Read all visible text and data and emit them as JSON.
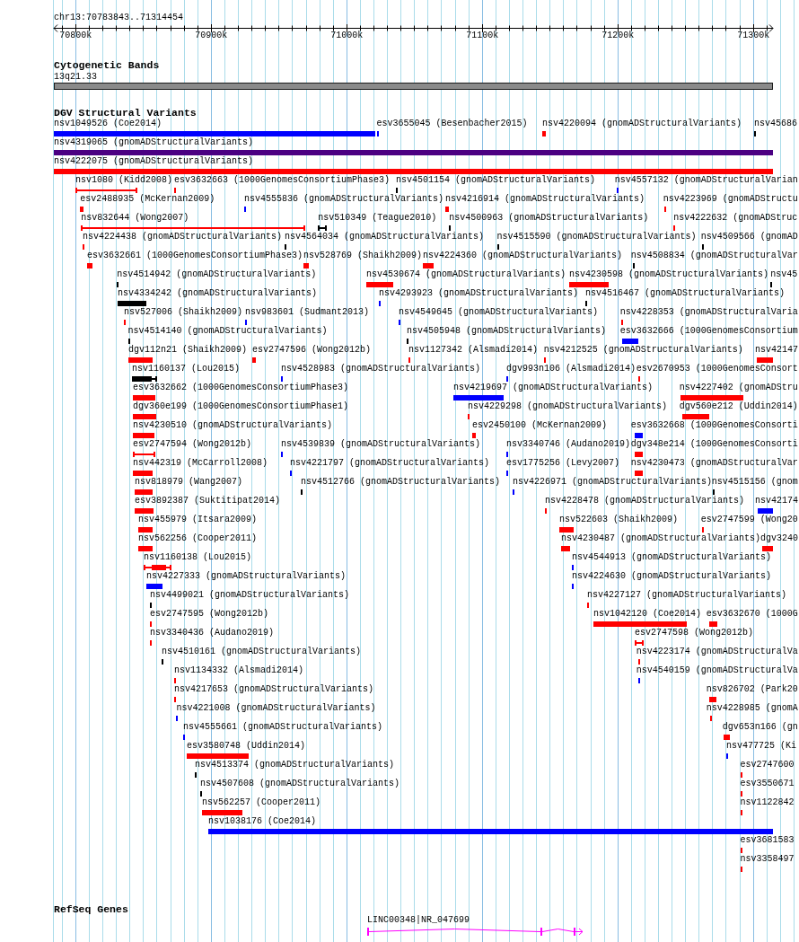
{
  "ruler": {
    "label": "chr13:70783843..71314454",
    "ticks": [
      "70800k",
      "70900k",
      "71000k",
      "71100k",
      "71200k",
      "71300k"
    ]
  },
  "tracks": [
    {
      "kind": "cytoband",
      "title": "Cytogenetic Bands",
      "bands": [
        {
          "label": "13q21.33"
        }
      ]
    },
    {
      "kind": "variants",
      "title": "DGV Structural Variants",
      "rows": [
        {
          "features": [
            {
              "label": "nsv1049526 (Coe2014)",
              "kind": "bar",
              "color": "#0000ff"
            },
            {
              "label": "esv3655045 (Besenbacher2015)",
              "kind": "bar",
              "color": "#0000ff"
            },
            {
              "label": "nsv4220094 (gnomADStructuralVariants)",
              "kind": "bar",
              "color": "#ff0000"
            },
            {
              "label": "nsv45686",
              "kind": "bar",
              "color": "#000000"
            }
          ]
        },
        {
          "features": [
            {
              "label": "nsv4319065 (gnomADStructuralVariants)",
              "kind": "bar",
              "color": "#4b0082"
            }
          ]
        },
        {
          "features": [
            {
              "label": "nsv4222075 (gnomADStructuralVariants)",
              "kind": "bar",
              "color": "#ff0000"
            }
          ]
        },
        {
          "features": [
            {
              "label": "nsv1080 (Kidd2008)",
              "kind": "span",
              "color": "#ff0000"
            },
            {
              "label": "esv3632663 (1000GenomesConsortiumPhase3)",
              "kind": "bar",
              "color": "#ff0000"
            },
            {
              "label": "nsv4501154 (gnomADStructuralVariants)",
              "kind": "bar",
              "color": "#000000"
            },
            {
              "label": "nsv4557132 (gnomADStructuralVarian",
              "kind": "bar",
              "color": "#0000ff"
            }
          ]
        },
        {
          "features": [
            {
              "label": "esv2488935 (McKernan2009)",
              "kind": "bar",
              "color": "#ff0000"
            },
            {
              "label": "nsv4555836 (gnomADStructuralVariants)",
              "kind": "bar",
              "color": "#0000ff"
            },
            {
              "label": "nsv4216914 (gnomADStructuralVariants)",
              "kind": "bar",
              "color": "#ff0000"
            },
            {
              "label": "nsv4223969 (gnomADStructu",
              "kind": "bar",
              "color": "#ff0000"
            }
          ]
        },
        {
          "features": [
            {
              "label": "nsv832644 (Wong2007)",
              "kind": "span",
              "color": "#ff0000"
            },
            {
              "label": "nsv510349 (Teague2010)",
              "kind": "span",
              "color": "#000000"
            },
            {
              "label": "nsv4500963 (gnomADStructuralVariants)",
              "kind": "bar",
              "color": "#000000"
            },
            {
              "label": "nsv4222632 (gnomADStruc",
              "kind": "bar",
              "color": "#ff0000"
            }
          ]
        },
        {
          "features": [
            {
              "label": "nsv4224438 (gnomADStructuralVariants)",
              "kind": "bar",
              "color": "#ff0000"
            },
            {
              "label": "nsv4564034 (gnomADStructuralVariants)",
              "kind": "bar",
              "color": "#000000"
            },
            {
              "label": "nsv4515590 (gnomADStructuralVariants)",
              "kind": "bar",
              "color": "#000000"
            },
            {
              "label": "nsv4509566 (gnomAD",
              "kind": "bar",
              "color": "#000000"
            }
          ]
        },
        {
          "features": [
            {
              "label": "esv3632661 (1000GenomesConsortiumPhase3)",
              "kind": "bar",
              "color": "#ff0000"
            },
            {
              "label": "nsv528769 (Shaikh2009)",
              "kind": "bar",
              "color": "#ff0000"
            },
            {
              "label": "nsv4224360 (gnomADStructuralVariants)",
              "kind": "bar",
              "color": "#ff0000"
            },
            {
              "label": "nsv4508834 (gnomADStructuralVar",
              "kind": "bar",
              "color": "#000000"
            }
          ]
        },
        {
          "features": [
            {
              "label": "nsv4514942 (gnomADStructuralVariants)",
              "kind": "bar",
              "color": "#000000"
            },
            {
              "label": "nsv4530674 (gnomADStructuralVariants)",
              "kind": "bar",
              "color": "#ff0000"
            },
            {
              "label": "nsv4230598 (gnomADStructuralVariants)",
              "kind": "bar",
              "color": "#ff0000"
            },
            {
              "label": "nsv45",
              "kind": "bar",
              "color": "#000000"
            }
          ]
        },
        {
          "features": [
            {
              "label": "nsv4334242 (gnomADStructuralVariants)",
              "kind": "bar",
              "color": "#000000"
            },
            {
              "label": "nsv4293923 (gnomADStructuralVariants)",
              "kind": "bar",
              "color": "#0000ff"
            },
            {
              "label": "nsv4516467 (gnomADStructuralVariants)",
              "kind": "bar",
              "color": "#000000"
            }
          ]
        },
        {
          "features": [
            {
              "label": "nsv527006 (Shaikh2009)",
              "kind": "bar",
              "color": "#ff0000"
            },
            {
              "label": "nsv983601 (Sudmant2013)",
              "kind": "bar",
              "color": "#0000ff"
            },
            {
              "label": "nsv4549645 (gnomADStructuralVariants)",
              "kind": "bar",
              "color": "#0000ff"
            },
            {
              "label": "nsv4228353 (gnomADStructuralVaria",
              "kind": "bar",
              "color": "#ff0000"
            }
          ]
        },
        {
          "features": [
            {
              "label": "nsv4514140 (gnomADStructuralVariants)",
              "kind": "bar",
              "color": "#000000"
            },
            {
              "label": "nsv4505948 (gnomADStructuralVariants)",
              "kind": "bar",
              "color": "#000000"
            },
            {
              "label": "esv3632666 (1000GenomesConsortium",
              "kind": "bar",
              "color": "#0000ff"
            }
          ]
        },
        {
          "features": [
            {
              "label": "dgv112n21 (Shaikh2009)",
              "kind": "bar",
              "color": "#ff0000"
            },
            {
              "label": "esv2747596 (Wong2012b)",
              "kind": "bar",
              "color": "#ff0000"
            },
            {
              "label": "nsv1127342 (Alsmadi2014)",
              "kind": "bar",
              "color": "#ff0000"
            },
            {
              "label": "nsv4212525 (gnomADStructuralVariants)",
              "kind": "bar",
              "color": "#ff0000"
            },
            {
              "label": "nsv42147",
              "kind": "bar",
              "color": "#ff0000"
            }
          ]
        },
        {
          "features": [
            {
              "label": "nsv1160137 (Lou2015)",
              "kind": "bar_span",
              "color": "#000000"
            },
            {
              "label": "nsv4528983 (gnomADStructuralVariants)",
              "kind": "bar",
              "color": "#0000ff"
            },
            {
              "label": "dgv993n106 (Alsmadi2014)",
              "kind": "bar",
              "color": "#0000ff"
            },
            {
              "label": "esv2670953 (1000GenomesConsort",
              "kind": "bar",
              "color": "#ff0000"
            }
          ]
        },
        {
          "features": [
            {
              "label": "esv3632662 (1000GenomesConsortiumPhase3)",
              "kind": "bar",
              "color": "#ff0000"
            },
            {
              "label": "nsv4219697 (gnomADStructuralVariants)",
              "kind": "bar",
              "color": "#0000ff"
            },
            {
              "label": "nsv4227402 (gnomADStru",
              "kind": "bar",
              "color": "#ff0000"
            }
          ]
        },
        {
          "features": [
            {
              "label": "dgv360e199 (1000GenomesConsortiumPhase1)",
              "kind": "bar",
              "color": "#ff0000"
            },
            {
              "label": "nsv4229298 (gnomADStructuralVariants)",
              "kind": "bar",
              "color": "#ff0000"
            },
            {
              "label": "dgv560e212 (Uddin2014)",
              "kind": "bar",
              "color": "#ff0000"
            }
          ]
        },
        {
          "features": [
            {
              "label": "nsv4230510 (gnomADStructuralVariants)",
              "kind": "bar",
              "color": "#ff0000"
            },
            {
              "label": "esv2450100 (McKernan2009)",
              "kind": "bar",
              "color": "#ff0000"
            },
            {
              "label": "esv3632668 (1000GenomesConsorti",
              "kind": "bar",
              "color": "#0000ff"
            }
          ]
        },
        {
          "features": [
            {
              "label": "esv2747594 (Wong2012b)",
              "kind": "span",
              "color": "#ff0000"
            },
            {
              "label": "nsv4539839 (gnomADStructuralVariants)",
              "kind": "bar",
              "color": "#0000ff"
            },
            {
              "label": "nsv3340746 (Audano2019)",
              "kind": "bar",
              "color": "#0000ff"
            },
            {
              "label": "dgv348e214 (1000GenomesConsorti",
              "kind": "bar",
              "color": "#ff0000"
            }
          ]
        },
        {
          "features": [
            {
              "label": "nsv442319 (McCarroll2008)",
              "kind": "bar",
              "color": "#ff0000"
            },
            {
              "label": "nsv4221797 (gnomADStructuralVariants)",
              "kind": "bar",
              "color": "#0000ff"
            },
            {
              "label": "esv1775256 (Levy2007)",
              "kind": "bar",
              "color": "#0000ff"
            },
            {
              "label": "nsv4230473 (gnomADStructuralVar",
              "kind": "bar",
              "color": "#ff0000"
            }
          ]
        },
        {
          "features": [
            {
              "label": "nsv818979 (Wang2007)",
              "kind": "bar",
              "color": "#ff0000"
            },
            {
              "label": "nsv4512766 (gnomADStructuralVariants)",
              "kind": "bar",
              "color": "#000000"
            },
            {
              "label": "nsv4226971 (gnomADStructuralVariants)",
              "kind": "bar",
              "color": "#0000ff"
            },
            {
              "label": "nsv4515156 (gnom",
              "kind": "bar",
              "color": "#000000"
            }
          ]
        },
        {
          "features": [
            {
              "label": "esv3892387 (Suktitipat2014)",
              "kind": "bar",
              "color": "#ff0000"
            },
            {
              "label": "nsv4228478 (gnomADStructuralVariants)",
              "kind": "bar",
              "color": "#ff0000"
            },
            {
              "label": "nsv42174",
              "kind": "bar",
              "color": "#0000ff"
            }
          ]
        },
        {
          "features": [
            {
              "label": "nsv455979 (Itsara2009)",
              "kind": "bar",
              "color": "#ff0000"
            },
            {
              "label": "nsv522603 (Shaikh2009)",
              "kind": "bar",
              "color": "#ff0000"
            },
            {
              "label": "esv2747599 (Wong20",
              "kind": "bar",
              "color": "#ff0000"
            }
          ]
        },
        {
          "features": [
            {
              "label": "nsv562256 (Cooper2011)",
              "kind": "bar",
              "color": "#ff0000"
            },
            {
              "label": "nsv4230487 (gnomADStructuralVariants)",
              "kind": "bar",
              "color": "#ff0000"
            },
            {
              "label": "dgv3240",
              "kind": "bar",
              "color": "#ff0000"
            }
          ]
        },
        {
          "features": [
            {
              "label": "nsv1160138 (Lou2015)",
              "kind": "bar_span",
              "color": "#ff0000"
            },
            {
              "label": "nsv4544913 (gnomADStructuralVariants)",
              "kind": "bar",
              "color": "#0000ff"
            }
          ]
        },
        {
          "features": [
            {
              "label": "nsv4227333 (gnomADStructuralVariants)",
              "kind": "bar",
              "color": "#0000ff"
            },
            {
              "label": "nsv4224630 (gnomADStructuralVariants)",
              "kind": "bar",
              "color": "#0000ff"
            }
          ]
        },
        {
          "features": [
            {
              "label": "nsv4499021 (gnomADStructuralVariants)",
              "kind": "bar",
              "color": "#000000"
            },
            {
              "label": "nsv4227127 (gnomADStructuralVariants)",
              "kind": "bar",
              "color": "#ff0000"
            }
          ]
        },
        {
          "features": [
            {
              "label": "esv2747595 (Wong2012b)",
              "kind": "bar",
              "color": "#ff0000"
            },
            {
              "label": "nsv1042120 (Coe2014)",
              "kind": "bar",
              "color": "#ff0000"
            },
            {
              "label": "esv3632670 (1000G",
              "kind": "bar",
              "color": "#ff0000"
            }
          ]
        },
        {
          "features": [
            {
              "label": "nsv3340436 (Audano2019)",
              "kind": "bar",
              "color": "#ff0000"
            },
            {
              "label": "esv2747598 (Wong2012b)",
              "kind": "span",
              "color": "#ff0000"
            }
          ]
        },
        {
          "features": [
            {
              "label": "nsv4510161 (gnomADStructuralVariants)",
              "kind": "bar",
              "color": "#000000"
            },
            {
              "label": "nsv4223174 (gnomADStructuralVa",
              "kind": "bar",
              "color": "#ff0000"
            }
          ]
        },
        {
          "features": [
            {
              "label": "nsv1134332 (Alsmadi2014)",
              "kind": "bar",
              "color": "#ff0000"
            },
            {
              "label": "nsv4540159 (gnomADStructuralVa",
              "kind": "bar",
              "color": "#0000ff"
            }
          ]
        },
        {
          "features": [
            {
              "label": "nsv4217653 (gnomADStructuralVariants)",
              "kind": "bar",
              "color": "#ff0000"
            },
            {
              "label": "nsv826702 (Park20",
              "kind": "bar",
              "color": "#ff0000"
            }
          ]
        },
        {
          "features": [
            {
              "label": "nsv4221008 (gnomADStructuralVariants)",
              "kind": "bar",
              "color": "#0000ff"
            },
            {
              "label": "nsv4228985 (gnomA",
              "kind": "bar",
              "color": "#ff0000"
            }
          ]
        },
        {
          "features": [
            {
              "label": "nsv4555661 (gnomADStructuralVariants)",
              "kind": "bar",
              "color": "#0000ff"
            },
            {
              "label": "dgv653n166 (gn",
              "kind": "bar",
              "color": "#ff0000"
            }
          ]
        },
        {
          "features": [
            {
              "label": "esv3580748 (Uddin2014)",
              "kind": "bar",
              "color": "#ff0000"
            },
            {
              "label": "nsv477725 (Ki",
              "kind": "bar",
              "color": "#0000ff"
            }
          ]
        },
        {
          "features": [
            {
              "label": "nsv4513374 (gnomADStructuralVariants)",
              "kind": "bar",
              "color": "#000000"
            },
            {
              "label": "esv2747600",
              "kind": "bar",
              "color": "#ff0000"
            }
          ]
        },
        {
          "features": [
            {
              "label": "nsv4507608 (gnomADStructuralVariants)",
              "kind": "bar",
              "color": "#000000"
            },
            {
              "label": "esv3550671",
              "kind": "bar",
              "color": "#ff0000"
            }
          ]
        },
        {
          "features": [
            {
              "label": "nsv562257 (Cooper2011)",
              "kind": "bar",
              "color": "#ff0000"
            },
            {
              "label": "nsv1122842",
              "kind": "bar",
              "color": "#ff0000"
            }
          ]
        },
        {
          "features": [
            {
              "label": "nsv1038176 (Coe2014)",
              "kind": "bar",
              "color": "#0000ff"
            }
          ]
        },
        {
          "features": [
            {
              "label": "esv3681583",
              "kind": "bar",
              "color": "#ff0000"
            }
          ]
        },
        {
          "features": [
            {
              "label": "nsv3358497",
              "kind": "bar",
              "color": "#ff0000"
            }
          ]
        }
      ]
    },
    {
      "kind": "genes",
      "title": "RefSeq Genes",
      "genes": [
        {
          "label": "LINC00348|NR_047699",
          "forward_strand": true
        }
      ]
    }
  ]
}
